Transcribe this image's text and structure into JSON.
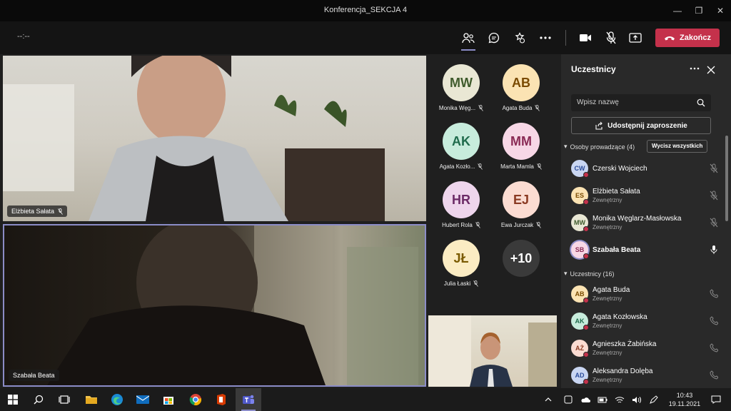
{
  "window": {
    "title": "Konferencja_SEKCJA 4"
  },
  "toolbar": {
    "timer": "--:--",
    "end_label": "Zakończ"
  },
  "videos": [
    {
      "name": "Elżbieta Sałata"
    },
    {
      "name": "Szabała Beata"
    }
  ],
  "tiles": [
    {
      "initials": "MW",
      "name": "Monika Węg...",
      "bg": "#e9e7d4",
      "fg": "#3f5b2c"
    },
    {
      "initials": "AB",
      "name": "Agata Buda",
      "bg": "#fbe3b3",
      "fg": "#7a4a00"
    },
    {
      "initials": "AK",
      "name": "Agata Kozło...",
      "bg": "#c7ecdc",
      "fg": "#1f6b4c"
    },
    {
      "initials": "MM",
      "name": "Marta Mamla",
      "bg": "#f7d7e6",
      "fg": "#8a2a55"
    },
    {
      "initials": "HR",
      "name": "Hubert Rola",
      "bg": "#eed5ec",
      "fg": "#6b2a66"
    },
    {
      "initials": "EJ",
      "name": "Ewa Jurczak",
      "bg": "#fbdcd2",
      "fg": "#8a3a22"
    },
    {
      "initials": "JŁ",
      "name": "Julia Łaski",
      "bg": "#fbecc3",
      "fg": "#7a5a00"
    },
    {
      "initials": "+10",
      "name": "",
      "bg": "#3a3a3a",
      "fg": "#ffffff"
    }
  ],
  "panel": {
    "title": "Uczestnicy",
    "search_placeholder": "Wpisz nazwę",
    "invite_label": "Udostępnij zaproszenie",
    "presenters_label": "Osoby prowadzące (4)",
    "mute_all_label": "Wycisz wszystkich",
    "attendees_label": "Uczestnicy (16)",
    "presenters": [
      {
        "initials": "CW",
        "name": "Czerski Wojciech",
        "sub": "",
        "bg": "#c9d6f2",
        "fg": "#2b4c9a"
      },
      {
        "initials": "ES",
        "name": "Elżbieta Sałata",
        "sub": "Zewnętrzny",
        "bg": "#fbe3b3",
        "fg": "#7a4a00"
      },
      {
        "initials": "MW",
        "name": "Monika Węglarz-Masłowska",
        "sub": "Zewnętrzny",
        "bg": "#e9e7d4",
        "fg": "#3f5b2c"
      },
      {
        "initials": "SB",
        "name": "Szabała Beata",
        "sub": "",
        "bg": "#f7d7e6",
        "fg": "#8a2a55"
      }
    ],
    "attendees": [
      {
        "initials": "AB",
        "name": "Agata Buda",
        "sub": "Zewnętrzny",
        "bg": "#fbe3b3",
        "fg": "#7a4a00"
      },
      {
        "initials": "AK",
        "name": "Agata Kozłowska",
        "sub": "Zewnętrzny",
        "bg": "#c7ecdc",
        "fg": "#1f6b4c"
      },
      {
        "initials": "AŻ",
        "name": "Agnieszka Żabińska",
        "sub": "Zewnętrzny",
        "bg": "#fbdcd2",
        "fg": "#8a3a22"
      },
      {
        "initials": "AD",
        "name": "Aleksandra Dolęba",
        "sub": "Zewnętrzny",
        "bg": "#c9d6f2",
        "fg": "#2b4c9a"
      }
    ]
  },
  "taskbar": {
    "time": "10:43",
    "date": "19.11.2021"
  },
  "colors": {
    "accent": "#8b8cc7",
    "end": "#c4314b"
  }
}
